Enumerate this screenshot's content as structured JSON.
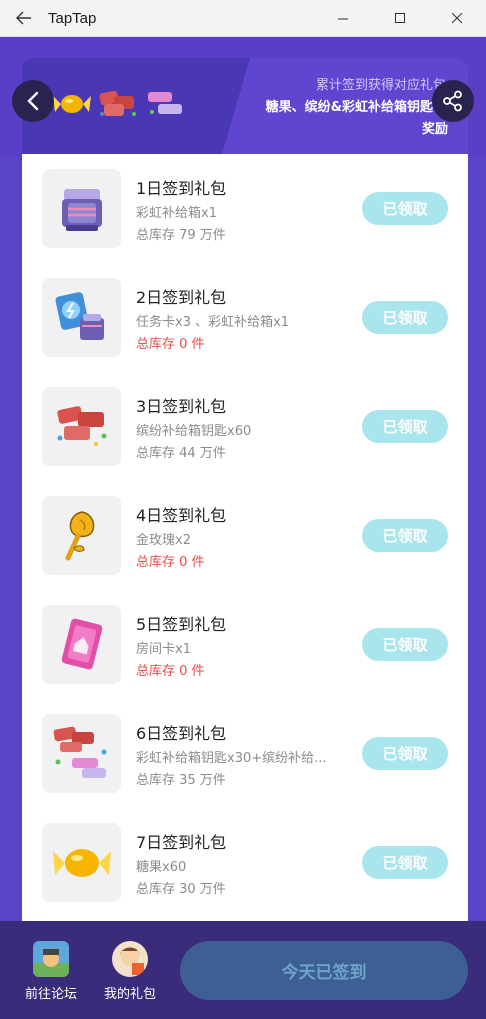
{
  "window": {
    "title": "TapTap"
  },
  "banner": {
    "line1": "累计签到获得对应礼包",
    "line2": "糖果、缤纷&彩虹补给箱钥匙等",
    "line3": "奖励"
  },
  "gifts": [
    {
      "title": "1日签到礼包",
      "desc": "彩虹补给箱x1",
      "stock": "总库存 79 万件",
      "stock_empty": false,
      "button": "已领取",
      "icon": "rainbow-crate-icon"
    },
    {
      "title": "2日签到礼包",
      "desc": "任务卡x3 、彩虹补给箱x1",
      "stock": "总库存 0 件",
      "stock_empty": true,
      "button": "已领取",
      "icon": "task-card-icon"
    },
    {
      "title": "3日签到礼包",
      "desc": "缤纷补给箱钥匙x60",
      "stock": "总库存 44 万件",
      "stock_empty": false,
      "button": "已领取",
      "icon": "colorful-key-icon"
    },
    {
      "title": "4日签到礼包",
      "desc": "金玫瑰x2",
      "stock": "总库存 0 件",
      "stock_empty": true,
      "button": "已领取",
      "icon": "gold-rose-icon"
    },
    {
      "title": "5日签到礼包",
      "desc": "房间卡x1",
      "stock": "总库存 0 件",
      "stock_empty": true,
      "button": "已领取",
      "icon": "room-card-icon"
    },
    {
      "title": "6日签到礼包",
      "desc": "彩虹补给箱钥匙x30+缤纷补给...",
      "stock": "总库存 35 万件",
      "stock_empty": false,
      "button": "已领取",
      "icon": "key-bundle-icon"
    },
    {
      "title": "7日签到礼包",
      "desc": "糖果x60",
      "stock": "总库存 30 万件",
      "stock_empty": false,
      "button": "已领取",
      "icon": "candy-icon"
    }
  ],
  "bottom": {
    "forum_label": "前往论坛",
    "mygift_label": "我的礼包",
    "signin_label": "今天已签到"
  }
}
